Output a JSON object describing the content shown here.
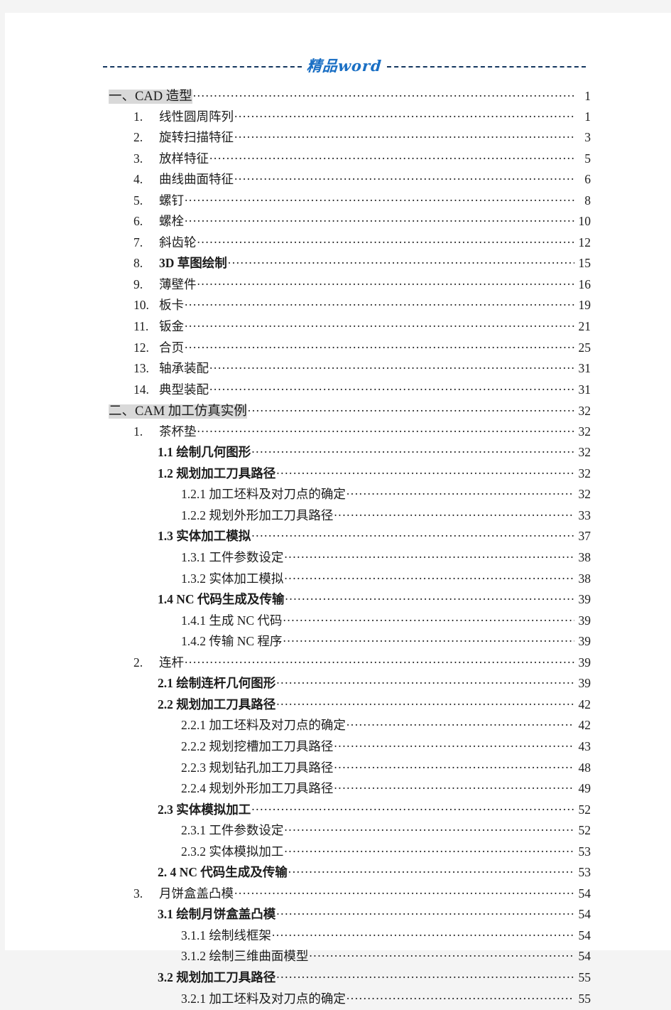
{
  "header": {
    "title": "精品word",
    "left_rule": "dashed-rule",
    "right_rule": "dashed-rule"
  },
  "colors": {
    "header_title": "#1a6fc4",
    "header_rule": "#14365f",
    "highlight": "#d9d9d9",
    "text": "#1c1c1c",
    "page_background": "#ffffff",
    "canvas_background": "#f4f4f4"
  },
  "toc": {
    "entries": [
      {
        "level": "h",
        "num": "",
        "label": "一、CAD 造型",
        "page": "1",
        "highlight": true,
        "bold": false
      },
      {
        "level": "1",
        "num": "1.",
        "label": "线性圆周阵列",
        "page": "1",
        "highlight": false,
        "bold": false
      },
      {
        "level": "1",
        "num": "2.",
        "label": "旋转扫描特征",
        "page": "3",
        "highlight": false,
        "bold": false
      },
      {
        "level": "1",
        "num": "3.",
        "label": "放样特征",
        "page": "5",
        "highlight": false,
        "bold": false
      },
      {
        "level": "1",
        "num": "4.",
        "label": "曲线曲面特征",
        "page": "6",
        "highlight": false,
        "bold": false
      },
      {
        "level": "1",
        "num": "5.",
        "label": "螺钉",
        "page": "8",
        "highlight": false,
        "bold": false
      },
      {
        "level": "1",
        "num": "6.",
        "label": "螺栓",
        "page": "10",
        "highlight": false,
        "bold": false
      },
      {
        "level": "1",
        "num": "7.",
        "label": "斜齿轮",
        "page": "12",
        "highlight": false,
        "bold": false
      },
      {
        "level": "1",
        "num": "8.",
        "label": "3D 草图绘制",
        "page": "15",
        "highlight": false,
        "bold": true
      },
      {
        "level": "1",
        "num": "9.",
        "label": "薄壁件",
        "page": "16",
        "highlight": false,
        "bold": false
      },
      {
        "level": "1",
        "num": "10.",
        "label": "板卡",
        "page": "19",
        "highlight": false,
        "bold": false
      },
      {
        "level": "1",
        "num": "11.",
        "label": "钣金",
        "page": "21",
        "highlight": false,
        "bold": false
      },
      {
        "level": "1",
        "num": "12.",
        "label": "合页",
        "page": "25",
        "highlight": false,
        "bold": false
      },
      {
        "level": "1",
        "num": "13.",
        "label": "轴承装配",
        "page": "31",
        "highlight": false,
        "bold": false
      },
      {
        "level": "1",
        "num": "14.",
        "label": "典型装配",
        "page": "31",
        "highlight": false,
        "bold": false
      },
      {
        "level": "h",
        "num": "",
        "label": "二、CAM 加工仿真实例",
        "page": "32",
        "highlight": true,
        "bold": false
      },
      {
        "level": "1",
        "num": "1.",
        "label": "茶杯垫",
        "page": "32",
        "highlight": false,
        "bold": false
      },
      {
        "level": "2",
        "num": "",
        "label": "1.1 绘制几何图形",
        "page": "32",
        "highlight": false,
        "bold": true
      },
      {
        "level": "2",
        "num": "",
        "label": "1.2 规划加工刀具路径",
        "page": "32",
        "highlight": false,
        "bold": true
      },
      {
        "level": "3",
        "num": "",
        "label": "1.2.1 加工坯料及对刀点的确定",
        "page": "32",
        "highlight": false,
        "bold": false
      },
      {
        "level": "3",
        "num": "",
        "label": "1.2.2 规划外形加工刀具路径",
        "page": "33",
        "highlight": false,
        "bold": false
      },
      {
        "level": "2",
        "num": "",
        "label": "1.3 实体加工模拟",
        "page": "37",
        "highlight": false,
        "bold": true
      },
      {
        "level": "3",
        "num": "",
        "label": "1.3.1 工件参数设定",
        "page": "38",
        "highlight": false,
        "bold": false
      },
      {
        "level": "3",
        "num": "",
        "label": "1.3.2 实体加工模拟",
        "page": "38",
        "highlight": false,
        "bold": false
      },
      {
        "level": "2",
        "num": "",
        "label": "1.4 NC 代码生成及传输",
        "page": "39",
        "highlight": false,
        "bold": true
      },
      {
        "level": "3",
        "num": "",
        "label": "1.4.1 生成 NC 代码",
        "page": "39",
        "highlight": false,
        "bold": false
      },
      {
        "level": "3",
        "num": "",
        "label": "1.4.2 传输 NC 程序",
        "page": "39",
        "highlight": false,
        "bold": false
      },
      {
        "level": "1",
        "num": "2.",
        "label": "连杆",
        "page": "39",
        "highlight": false,
        "bold": false
      },
      {
        "level": "2",
        "num": "",
        "label": "2.1 绘制连杆几何图形",
        "page": "39",
        "highlight": false,
        "bold": true
      },
      {
        "level": "2",
        "num": "",
        "label": "2.2 规划加工刀具路径",
        "page": "42",
        "highlight": false,
        "bold": true
      },
      {
        "level": "3",
        "num": "",
        "label": "2.2.1 加工坯料及对刀点的确定",
        "page": "42",
        "highlight": false,
        "bold": false
      },
      {
        "level": "3",
        "num": "",
        "label": "2.2.2 规划挖槽加工刀具路径",
        "page": "43",
        "highlight": false,
        "bold": false
      },
      {
        "level": "3",
        "num": "",
        "label": "2.2.3 规划钻孔加工刀具路径",
        "page": "48",
        "highlight": false,
        "bold": false
      },
      {
        "level": "3",
        "num": "",
        "label": "2.2.4 规划外形加工刀具路径",
        "page": "49",
        "highlight": false,
        "bold": false
      },
      {
        "level": "2",
        "num": "",
        "label": "2.3 实体模拟加工",
        "page": "52",
        "highlight": false,
        "bold": true
      },
      {
        "level": "3",
        "num": "",
        "label": "2.3.1 工件参数设定",
        "page": "52",
        "highlight": false,
        "bold": false
      },
      {
        "level": "3",
        "num": "",
        "label": "2.3.2 实体模拟加工",
        "page": "53",
        "highlight": false,
        "bold": false
      },
      {
        "level": "2",
        "num": "",
        "label": "2. 4 NC 代码生成及传输",
        "page": "53",
        "highlight": false,
        "bold": true
      },
      {
        "level": "1",
        "num": "3.",
        "label": "月饼盒盖凸模",
        "page": "54",
        "highlight": false,
        "bold": false
      },
      {
        "level": "2",
        "num": "",
        "label": "3.1 绘制月饼盒盖凸模",
        "page": "54",
        "highlight": false,
        "bold": true
      },
      {
        "level": "3",
        "num": "",
        "label": "3.1.1 绘制线框架",
        "page": "54",
        "highlight": false,
        "bold": false
      },
      {
        "level": "3",
        "num": "",
        "label": "3.1.2 绘制三维曲面模型",
        "page": "54",
        "highlight": false,
        "bold": false
      },
      {
        "level": "2",
        "num": "",
        "label": "3.2 规划加工刀具路径",
        "page": "55",
        "highlight": false,
        "bold": true
      },
      {
        "level": "3",
        "num": "",
        "label": "3.2.1 加工坯料及对刀点的确定",
        "page": "55",
        "highlight": false,
        "bold": false
      }
    ]
  }
}
